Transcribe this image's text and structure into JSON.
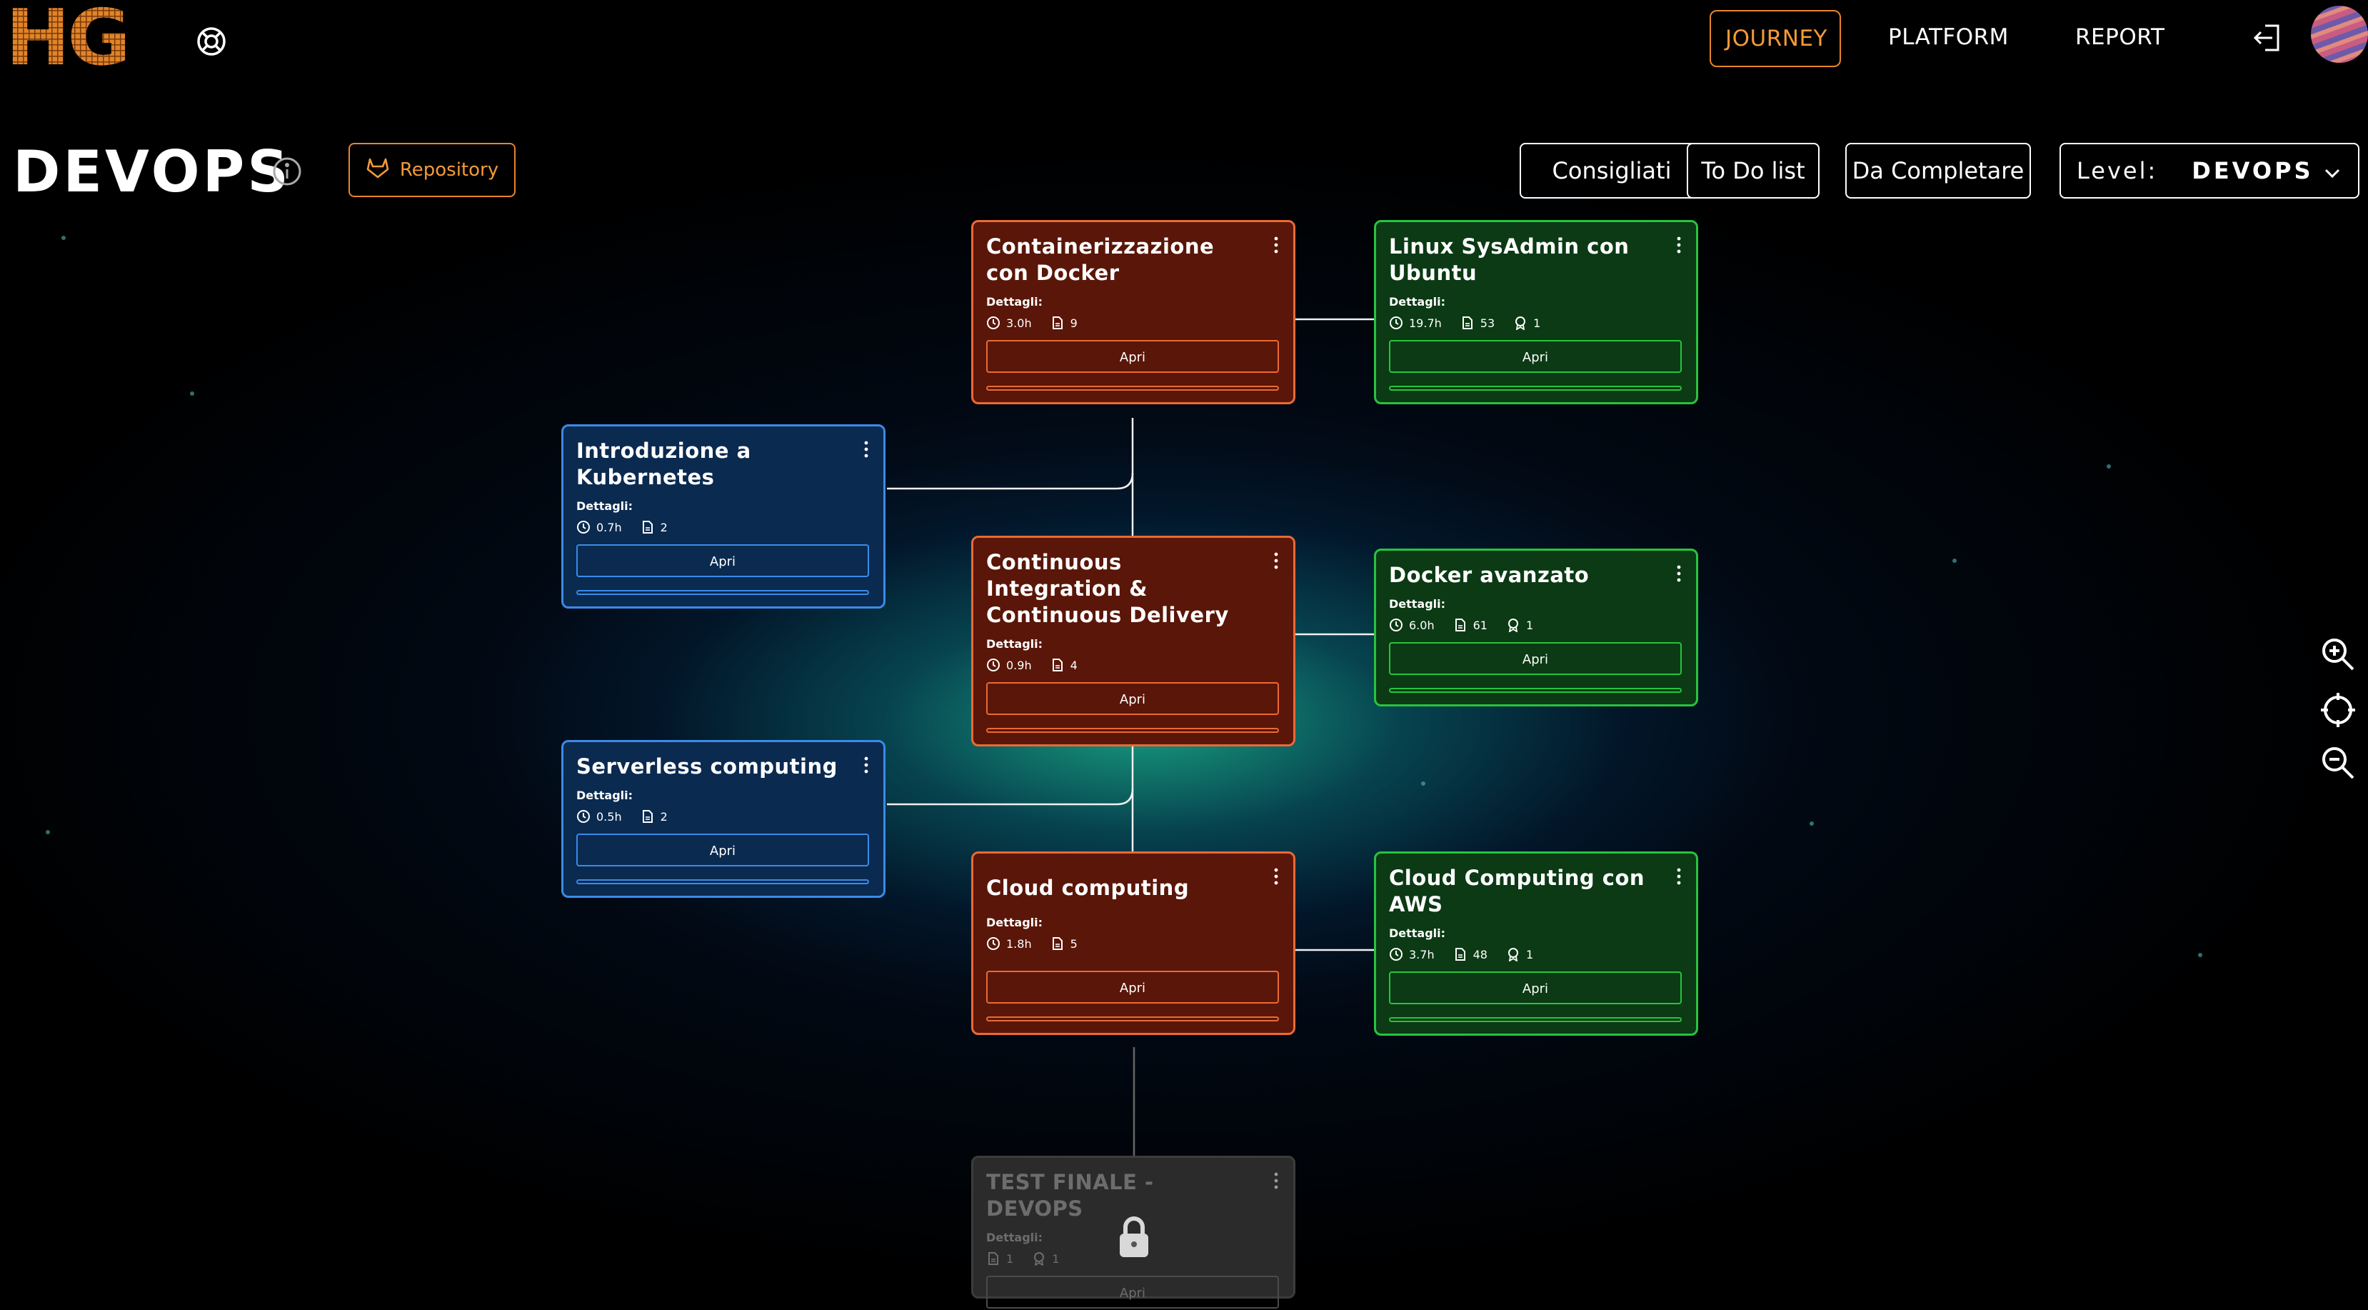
{
  "header": {
    "logo_text": "HG",
    "nav": {
      "journey": "JOURNEY",
      "platform": "PLATFORM",
      "report": "REPORT"
    },
    "active_nav": "journey"
  },
  "page": {
    "title": "DEVOPS",
    "repository_label": "Repository",
    "filters": {
      "consigliati": "Consigliati",
      "todo": "To Do list",
      "dacompletare": "Da Completare"
    },
    "level": {
      "label": "Level:",
      "value": "DEVOPS"
    }
  },
  "colors": {
    "accent": "#f39a3a",
    "orange_card": "#5a1608",
    "green_card": "#0b3a14",
    "blue_card": "#0b2a50"
  },
  "cards": [
    {
      "title": "Containerizzazione con Docker",
      "details_label": "Dettagli:",
      "hours": "3.0h",
      "docs": "9",
      "button": "Apri"
    },
    {
      "title": "Linux SysAdmin con Ubuntu",
      "details_label": "Dettagli:",
      "hours": "19.7h",
      "docs": "53",
      "badges": "1",
      "button": "Apri"
    },
    {
      "title": "Introduzione a Kubernetes",
      "details_label": "Dettagli:",
      "hours": "0.7h",
      "docs": "2",
      "button": "Apri"
    },
    {
      "title": "Continuous Integration & Continuous Delivery",
      "details_label": "Dettagli:",
      "hours": "0.9h",
      "docs": "4",
      "button": "Apri"
    },
    {
      "title": "Docker avanzato",
      "details_label": "Dettagli:",
      "hours": "6.0h",
      "docs": "61",
      "badges": "1",
      "button": "Apri"
    },
    {
      "title": "Serverless computing",
      "details_label": "Dettagli:",
      "hours": "0.5h",
      "docs": "2",
      "button": "Apri"
    },
    {
      "title": "Cloud computing",
      "details_label": "Dettagli:",
      "hours": "1.8h",
      "docs": "5",
      "button": "Apri"
    },
    {
      "title": "Cloud Computing con AWS",
      "details_label": "Dettagli:",
      "hours": "3.7h",
      "docs": "48",
      "badges": "1",
      "button": "Apri"
    },
    {
      "title": "TEST FINALE - DEVOPS",
      "details_label": "Dettagli:",
      "docs": "1",
      "badges": "1",
      "button": "Apri",
      "locked": true
    }
  ],
  "icons": {
    "help": "lifebuoy-icon",
    "logout": "logout-icon",
    "info": "info-icon",
    "repo": "gitlab-icon",
    "clock": "clock-icon",
    "doc": "document-icon",
    "badge": "badge-icon",
    "lock": "lock-icon",
    "zoom_in": "zoom-in-icon",
    "recenter": "crosshair-icon",
    "zoom_out": "zoom-out-icon"
  }
}
